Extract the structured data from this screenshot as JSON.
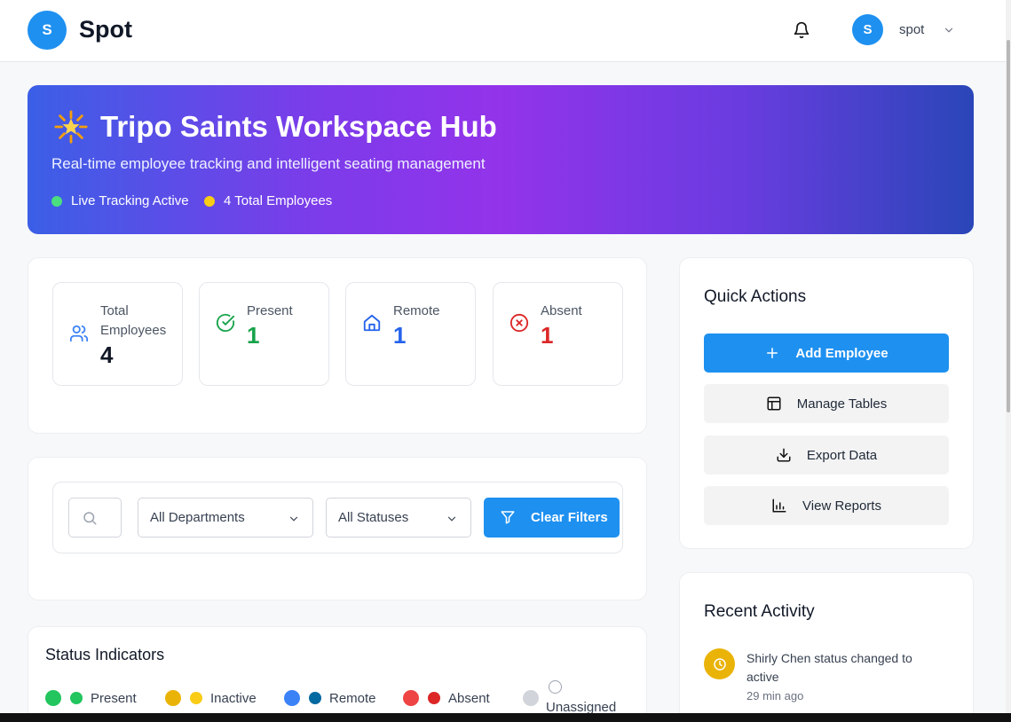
{
  "app": {
    "logo_letter": "S",
    "name": "Spot"
  },
  "user": {
    "avatar_letter": "S",
    "name": "spot"
  },
  "hero": {
    "emoji": "star-icon",
    "title": "Tripo Saints Workspace Hub",
    "subtitle": "Real-time employee tracking and intelligent seating management",
    "pills": [
      {
        "label": "Live Tracking Active",
        "color": "#4ade80"
      },
      {
        "label": "4 Total Employees",
        "color": "#facc15"
      }
    ]
  },
  "stats": [
    {
      "label_line1": "Total",
      "label_line2": "Employees",
      "value": "4",
      "icon": "users-icon",
      "color": "#111827"
    },
    {
      "label": "Present",
      "value": "1",
      "icon": "check-circle-icon",
      "color": "#16a34a"
    },
    {
      "label": "Remote",
      "value": "1",
      "icon": "home-icon",
      "color": "#2563eb"
    },
    {
      "label": "Absent",
      "value": "1",
      "icon": "x-circle-icon",
      "color": "#dc2626"
    }
  ],
  "filters": {
    "department": "All Departments",
    "status": "All Statuses",
    "clear_label": "Clear Filters"
  },
  "quick_actions": {
    "title": "Quick Actions",
    "buttons": [
      {
        "label": "Add Employee",
        "icon": "plus-icon"
      },
      {
        "label": "Manage Tables",
        "icon": "table-icon"
      },
      {
        "label": "Export Data",
        "icon": "download-icon"
      },
      {
        "label": "View Reports",
        "icon": "bar-chart-icon"
      }
    ]
  },
  "status_indicators": {
    "title": "Status Indicators",
    "items": [
      {
        "label": "Present",
        "color1": "#22c55e",
        "color2": "#22c55e"
      },
      {
        "label": "Inactive",
        "color1": "#eab308",
        "color2": "#facc15"
      },
      {
        "label": "Remote",
        "color1": "#3b82f6",
        "color2": "#0369a1"
      },
      {
        "label": "Absent",
        "color1": "#ef4444",
        "color2": "#dc2626"
      },
      {
        "label": "Unassigned",
        "color1": "#d1d5db",
        "color2": "#ffffff"
      }
    ]
  },
  "recent_activity": {
    "title": "Recent Activity",
    "items": [
      {
        "text": "Shirly Chen status changed to active",
        "time": "29 min ago",
        "icon": "clock-icon",
        "color": "#eab308"
      }
    ]
  }
}
